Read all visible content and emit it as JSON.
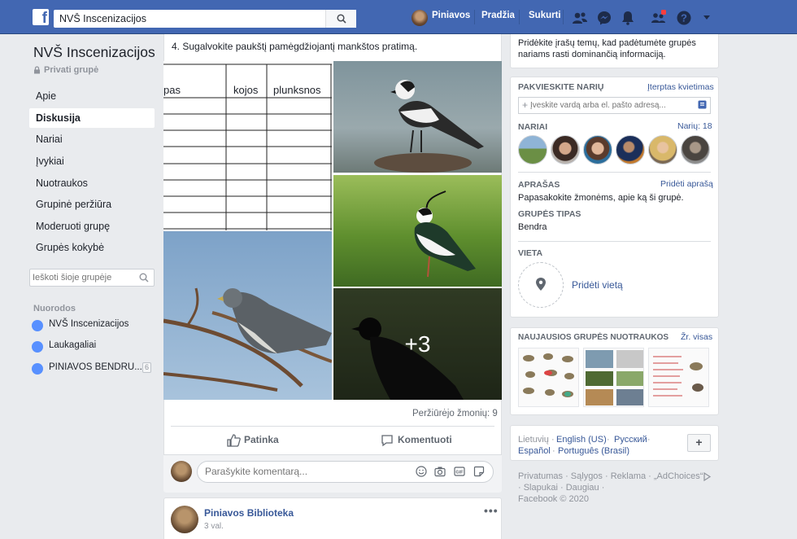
{
  "topbar": {
    "search_value": "NVŠ Inscenizacijos",
    "user_name": "Piniavos",
    "home_label": "Pradžia",
    "create_label": "Sukurti"
  },
  "group": {
    "title": "NVŠ Inscenizacijos",
    "privacy": "Privati grupė"
  },
  "nav": {
    "items": [
      "Apie",
      "Diskusija",
      "Nariai",
      "Įvykiai",
      "Nuotraukos",
      "Grupinė peržiūra",
      "Moderuoti grupę",
      "Grupės kokybė"
    ],
    "active": "Diskusija"
  },
  "group_search": {
    "placeholder": "Ieškoti šioje grupėje"
  },
  "shortcuts": {
    "label": "Nuorodos",
    "items": [
      {
        "name": "NVŠ Inscenizacijos",
        "badge": ""
      },
      {
        "name": "Laukagaliai",
        "badge": ""
      },
      {
        "name": "PINIAVOS BENDRU...",
        "badge": "6"
      }
    ]
  },
  "post": {
    "text_line": "4. Sugalvokite paukštį pamėgdžiojantį mankštos pratimą.",
    "table_headers": [
      "pas",
      "kojos",
      "plunksnos"
    ],
    "more_count": "+3",
    "views": "Peržiūrėjo žmonių: 9",
    "like_label": "Patinka",
    "comment_label": "Komentuoti",
    "comment_placeholder": "Parašykite komentarą..."
  },
  "post2": {
    "author": "Piniavos Biblioteka",
    "time": "3 val.",
    "menu": "•••"
  },
  "right": {
    "top_text_1": "Pridėkite įrašų temų, kad padėtumėte grupės",
    "top_text_2": "nariams rasti dominančią informaciją.",
    "invite_header": "PAKVIESKITE NARIŲ",
    "invite_link": "Įterptas kvietimas",
    "invite_placeholder": "Įveskite vardą arba el. pašto adresą...",
    "members_header": "NARIAI",
    "members_link": "Narių: 18",
    "description_header": "APRAŠAS",
    "description_link": "Pridėti aprašą",
    "description_text": "Papasakokite žmonėms, apie ką ši grupė.",
    "type_header": "GRUPĖS TIPAS",
    "type_value": "Bendra",
    "location_header": "VIETA",
    "location_link": "Pridėti vietą",
    "photos_header": "NAUJAUSIOS GRUPĖS NUOTRAUKOS",
    "photos_link": "Žr. visas"
  },
  "languages": {
    "current": "Lietuvių",
    "options": [
      "English (US)",
      "Русский",
      "Español",
      "Português (Brasil)"
    ],
    "add": "+"
  },
  "footer": {
    "line1": "Privatumas · Sąlygos · Reklama · „AdChoices“",
    "line2": "· Slapukai · Daugiau ·",
    "line3": "Facebook © 2020"
  },
  "colors": {
    "brand_blue": "#4267b2",
    "link_blue": "#385898",
    "notification_red": "#fa3e3e"
  }
}
